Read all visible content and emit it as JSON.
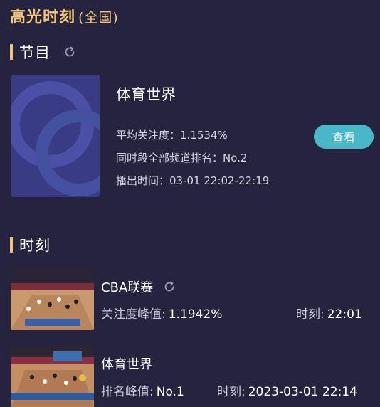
{
  "header": {
    "title": "高光时刻",
    "scope": "(全国)"
  },
  "program_section": {
    "label": "节目",
    "refresh_icon": "refresh-icon",
    "program": {
      "name": "体育世界",
      "avg_attention_label": "平均关注度：",
      "avg_attention_value": "1.1534%",
      "rank_label": "同时段全部频道排名：",
      "rank_value": "No.2",
      "airtime_label": "播出时间：",
      "airtime_value": "03-01 22:02-22:19",
      "view_label": "查看"
    }
  },
  "moments_section": {
    "label": "时刻",
    "items": [
      {
        "title": "CBA联赛",
        "stat_label": "关注度峰值:",
        "stat_value": "1.1942%",
        "time_label": "时刻:",
        "time_value": "22:01",
        "has_refresh_icon": true
      },
      {
        "title": "体育世界",
        "stat_label": "排名峰值:",
        "stat_value": "No.1",
        "time_label": "时刻:",
        "time_value": "2023-03-01 22:14",
        "has_refresh_icon": false
      }
    ]
  },
  "colors": {
    "background": "#26233f",
    "accent_gold": "#f1c67b",
    "button_teal": "#48b8c9"
  }
}
